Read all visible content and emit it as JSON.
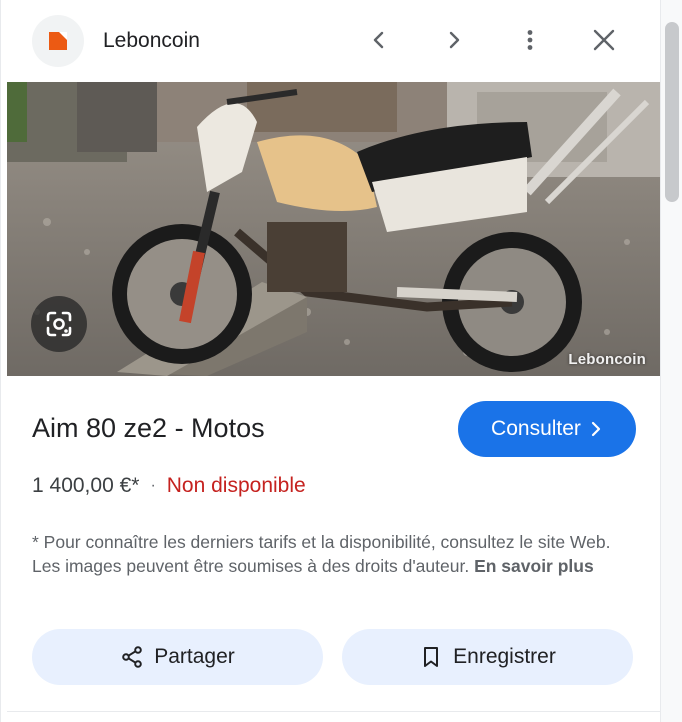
{
  "header": {
    "site_name": "Leboncoin",
    "icons": {
      "previous": "chevron-left-icon",
      "next": "chevron-right-icon",
      "more": "more-vert-icon",
      "close": "close-icon"
    }
  },
  "image": {
    "watermark": "Leboncoin",
    "lens_icon": "google-lens-icon"
  },
  "listing": {
    "title": "Aim 80 ze2 - Motos",
    "price": "1 400,00 €*",
    "separator": "·",
    "availability": "Non disponible",
    "consult_label": "Consulter",
    "disclaimer": "* Pour connaître les derniers tarifs et la disponibilité, consultez le site Web. Les images peuvent être soumises à des droits d'auteur.",
    "learn_more": "En savoir plus"
  },
  "actions": {
    "share_label": "Partager",
    "save_label": "Enregistrer"
  },
  "colors": {
    "accent": "#1a73e8",
    "unavailable": "#c5221f",
    "action_bg": "#e8f0fe",
    "brand": "#ec5a13"
  }
}
